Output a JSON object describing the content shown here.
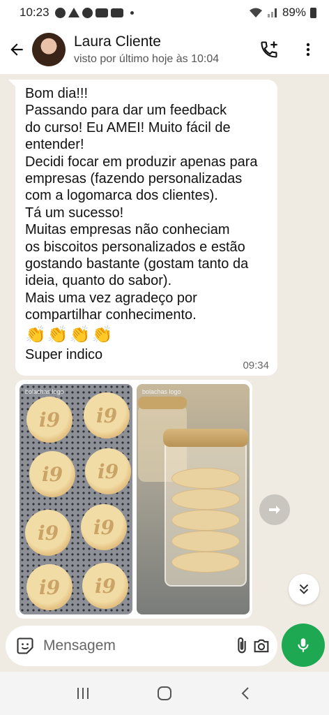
{
  "status_bar": {
    "time": "10:23",
    "battery": "89%"
  },
  "header": {
    "contact_name": "Laura Cliente",
    "contact_status": "visto por último hoje às 10:04"
  },
  "message": {
    "lines": [
      "Bom dia!!!",
      "Passando para dar um feedback",
      "do curso! Eu AMEI! Muito fácil de",
      "entender!",
      "Decidi focar em produzir apenas para",
      "empresas (fazendo personalizadas",
      "com a logomarca dos clientes).",
      "Tá um sucesso!",
      "Muitas empresas não conheciam",
      "os biscoitos personalizados e estão",
      "gostando bastante (gostam tanto da",
      "ideia, quanto do sabor).",
      "Mais uma vez agradeço por",
      "compartilhar conhecimento."
    ],
    "emojis": "👏👏👏👏",
    "closing": "Super indico",
    "time": "09:34"
  },
  "images": {
    "photo1_label": "bolachas logo",
    "photo2_label": "bolachas logo",
    "cookie_mark": "i9"
  },
  "input": {
    "placeholder": "Mensagem"
  },
  "icons": {
    "back": "arrow-left-icon",
    "call": "phone-add-icon",
    "menu": "more-vert-icon",
    "share": "forward-icon",
    "scroll": "chevron-double-down-icon",
    "sticker": "sticker-icon",
    "attach": "paperclip-icon",
    "camera": "camera-icon",
    "mic": "mic-icon"
  },
  "colors": {
    "accent": "#1da851",
    "chat_background": "#efeae2",
    "bubble": "#ffffff"
  }
}
